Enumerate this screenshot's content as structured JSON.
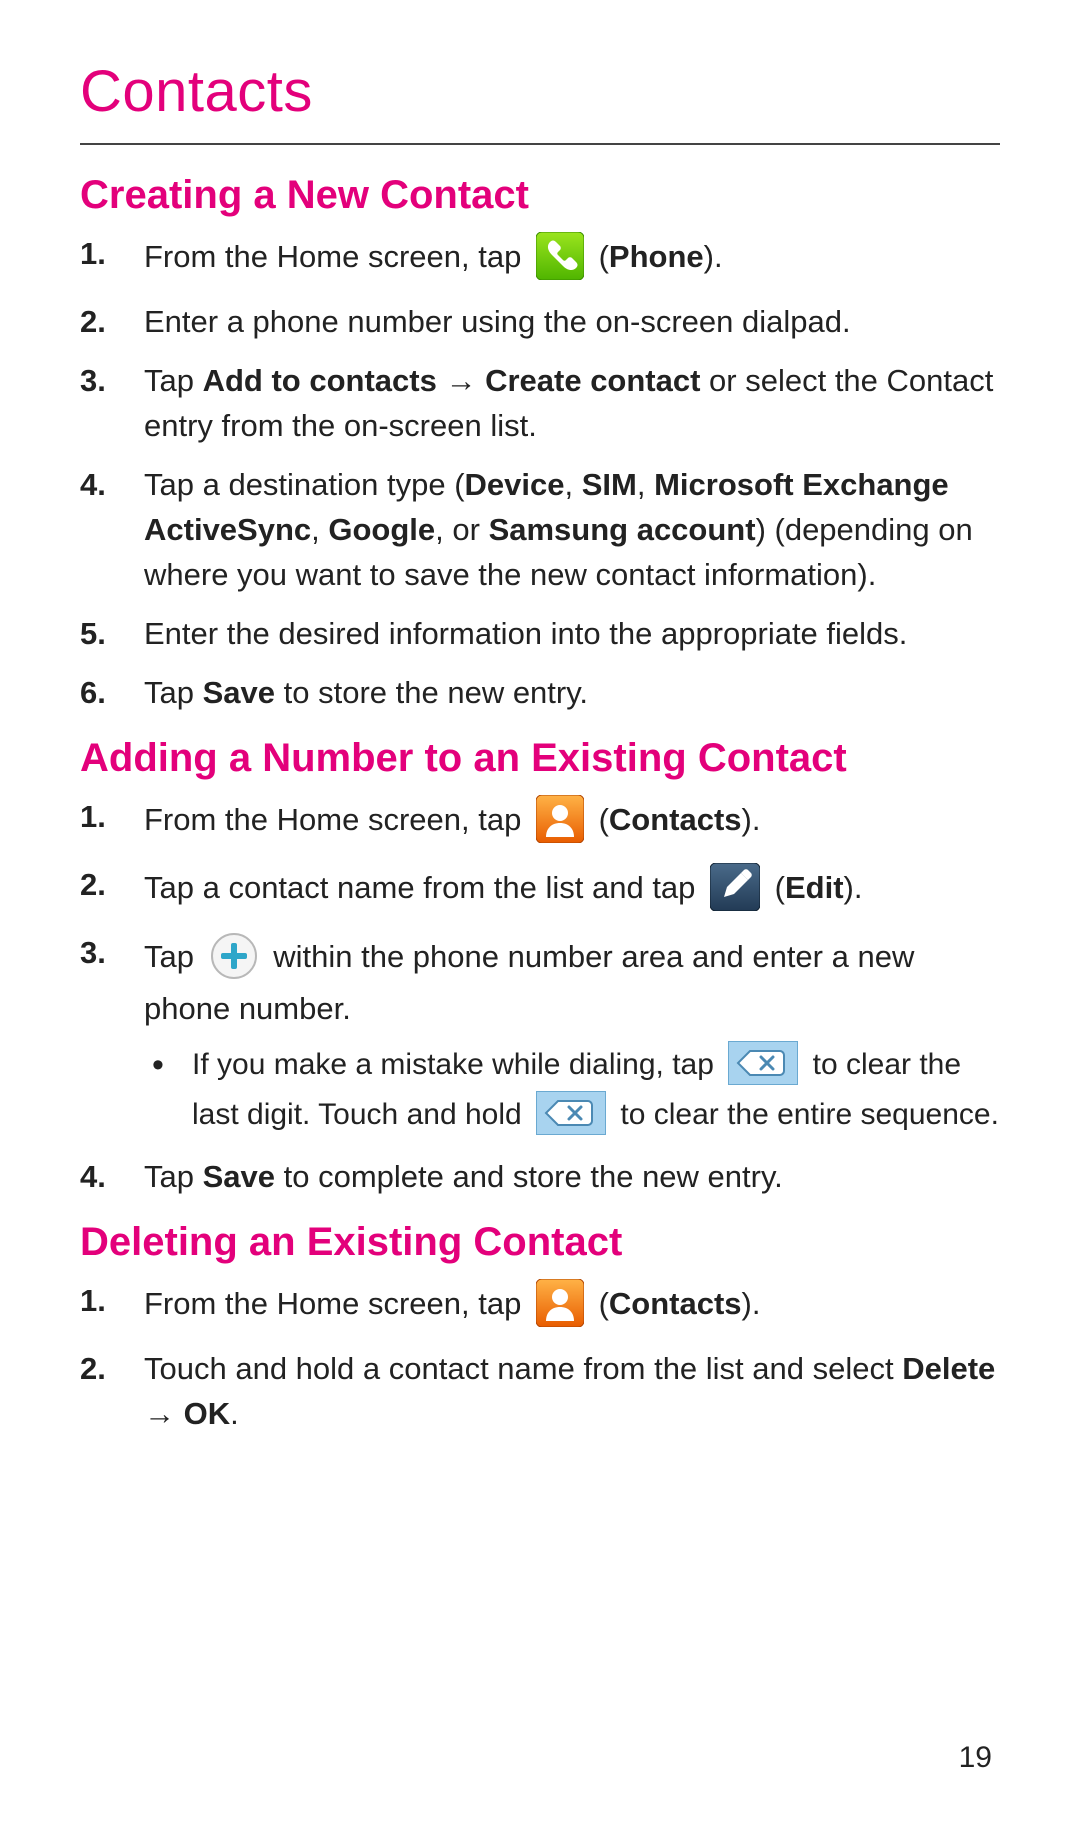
{
  "page_number": "19",
  "title": "Contacts",
  "sections": [
    {
      "heading": "Creating a New Contact",
      "steps": [
        {
          "pre": "From the Home screen, tap ",
          "icon": "phone",
          "post_open": " (",
          "post_bold": "Phone",
          "post_close": ")."
        },
        {
          "plain": "Enter a phone number using the on-screen dialpad."
        },
        {
          "a": "Tap ",
          "b1": "Add to contacts",
          "arrow": " → ",
          "b2": "Create contact",
          "c": " or select the Contact entry from the on-screen list."
        },
        {
          "a": "Tap a destination type (",
          "b1": "Device",
          "sep1": ", ",
          "b2": "SIM",
          "sep2": ", ",
          "b3": "Microsoft Exchange ActiveSync",
          "sep3": ", ",
          "b4": "Google",
          "sep4": ", or ",
          "b5": "Samsung account",
          "c": ") (depending on where you want to save the new contact information)."
        },
        {
          "plain": "Enter the desired information into the appropriate fields."
        },
        {
          "a": "Tap ",
          "b1": "Save",
          "c": " to store the new entry."
        }
      ]
    },
    {
      "heading": "Adding a Number to an Existing Contact",
      "steps": [
        {
          "pre": "From the Home screen, tap ",
          "icon": "contacts",
          "post_open": " (",
          "post_bold": "Contacts",
          "post_close": ")."
        },
        {
          "pre": "Tap a contact name from the list and tap ",
          "icon": "edit",
          "post_open": " (",
          "post_bold": "Edit",
          "post_close": ")."
        },
        {
          "pre": "Tap ",
          "icon": "plus",
          "post_plain": " within the phone number area and enter a new phone number.",
          "bullets": [
            {
              "a": "If you make a mistake while dialing, tap ",
              "icon1": "backspace",
              "b": " to clear the last digit. Touch and hold ",
              "icon2": "backspace",
              "c": " to clear the entire sequence."
            }
          ]
        },
        {
          "a": "Tap ",
          "b1": "Save",
          "c": " to complete and store the new entry."
        }
      ]
    },
    {
      "heading": "Deleting an Existing Contact",
      "steps": [
        {
          "pre": "From the Home screen, tap ",
          "icon": "contacts",
          "post_open": " (",
          "post_bold": "Contacts",
          "post_close": ")."
        },
        {
          "a": "Touch and hold a contact name from the list and select ",
          "b1": "Delete",
          "arrow": " → ",
          "b2": "OK",
          "c": "."
        }
      ]
    }
  ]
}
